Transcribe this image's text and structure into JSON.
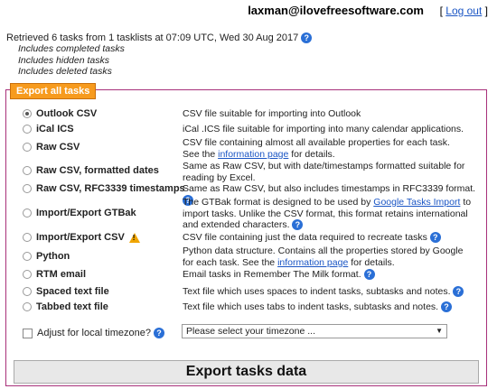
{
  "header": {
    "email": "laxman@ilovefreesoftware.com",
    "logout_open": "[",
    "logout_label": "Log out",
    "logout_close": "]"
  },
  "info": {
    "retrieved": "Retrieved 6 tasks from 1 tasklists at 07:09 UTC, Wed 30 Aug 2017",
    "lines": [
      "Includes completed tasks",
      "Includes hidden tasks",
      "Includes deleted tasks"
    ]
  },
  "panel_title": "Export all tasks",
  "options": [
    {
      "label": "Outlook CSV",
      "desc": "CSV file suitable for importing into Outlook",
      "checked": true
    },
    {
      "label": "iCal ICS",
      "desc": "iCal .ICS file suitable for importing into many calendar applications."
    },
    {
      "label": "Raw CSV",
      "desc_a": "CSV file containing almost all available properties for each task.",
      "desc_b": "See the",
      "link": "information page",
      "desc_c": "for details."
    },
    {
      "label": "Raw CSV, formatted dates",
      "desc": "Same as Raw CSV, but with date/timestamps formatted suitable for reading by Excel."
    },
    {
      "label": "Raw CSV, RFC3339 timestamps",
      "desc": "Same as Raw CSV, but also includes timestamps in RFC3339 format."
    },
    {
      "label": "Import/Export GTBak",
      "desc_a": "The GTBak format is designed to be used by",
      "link": "Google Tasks Import",
      "desc_c": "to import tasks. Unlike the CSV format, this format retains international and extended characters."
    },
    {
      "label": "Import/Export CSV",
      "desc": "CSV file containing just the data required to recreate tasks"
    },
    {
      "label": "Python",
      "desc_a": "Python data structure. Contains all the properties stored by Google for each task. See the",
      "link": "information page",
      "desc_c": "for details."
    },
    {
      "label": "RTM email",
      "desc": "Email tasks in Remember The Milk format."
    },
    {
      "label": "Spaced text file",
      "desc": "Text file which uses spaces to indent tasks, subtasks and notes."
    },
    {
      "label": "Tabbed text file",
      "desc": "Text file which uses tabs to indent tasks, subtasks and notes."
    }
  ],
  "timezone": {
    "label": "Adjust for local timezone?",
    "placeholder": "Please select your timezone ..."
  },
  "export_button": "Export tasks data"
}
